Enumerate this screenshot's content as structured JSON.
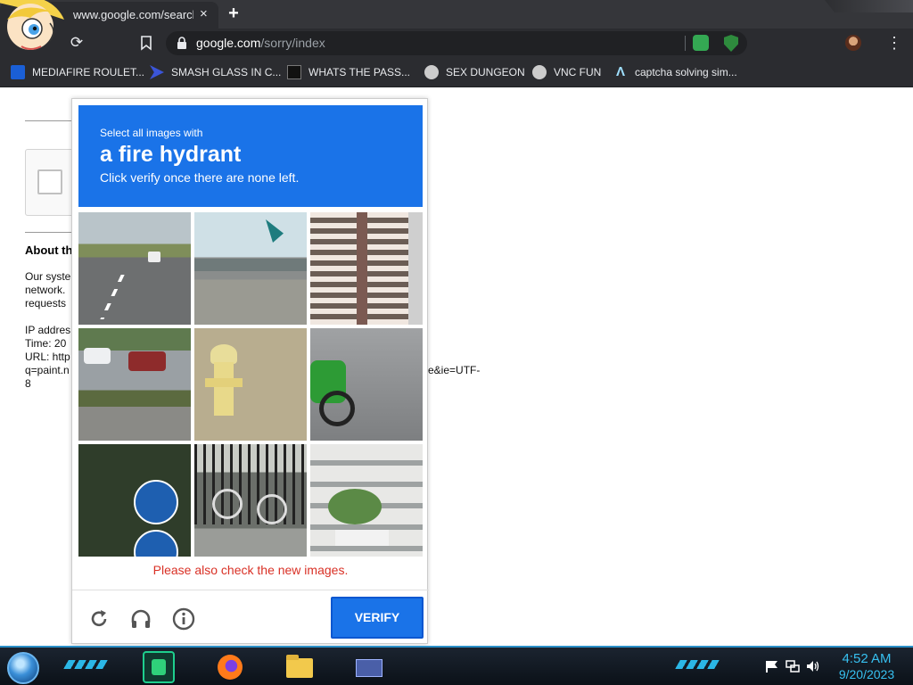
{
  "browser": {
    "tab_title": "www.google.com/search?q",
    "tab_close": "×",
    "new_tab": "+",
    "url_host": "google.com",
    "url_path": "/sorry/index",
    "bookmarks": [
      {
        "label": "MEDIAFIRE ROULET...",
        "icon": "mediafire-icon"
      },
      {
        "label": "SMASH GLASS IN C...",
        "icon": "smash-glass-icon"
      },
      {
        "label": "WHATS THE PASS...",
        "icon": "password-icon"
      },
      {
        "label": "SEX DUNGEON",
        "icon": "bookmark-site-icon"
      },
      {
        "label": "VNC FUN",
        "icon": "vnc-icon"
      },
      {
        "label": "captcha solving sim...",
        "icon": "captcha-site-icon"
      }
    ]
  },
  "sorry_page": {
    "heading": "About th",
    "para1": [
      "Our syste",
      "network.",
      "requests"
    ],
    "para2": [
      "IP addres",
      "Time: 20",
      "URL: http",
      "q=paint.n",
      "8"
    ],
    "url_tail": "e&ie=UTF-"
  },
  "challenge": {
    "line1": "Select all images with",
    "target": "a fire hydrant",
    "line3": "Click verify once there are none left.",
    "error": "Please also check the new images.",
    "verify_label": "VERIFY",
    "tiles": [
      "highway-road",
      "bridge-overpass",
      "building-vent",
      "parked-cars-street",
      "fire-hydrant",
      "motorcycle",
      "bike-path-sign",
      "bicycle-fence",
      "building-facade"
    ]
  },
  "taskbar": {
    "time": "4:52 AM",
    "date": "9/20/2023"
  },
  "colors": {
    "captcha_blue": "#1a73e8",
    "error_red": "#d93025",
    "clock_cyan": "#37c0f0"
  }
}
